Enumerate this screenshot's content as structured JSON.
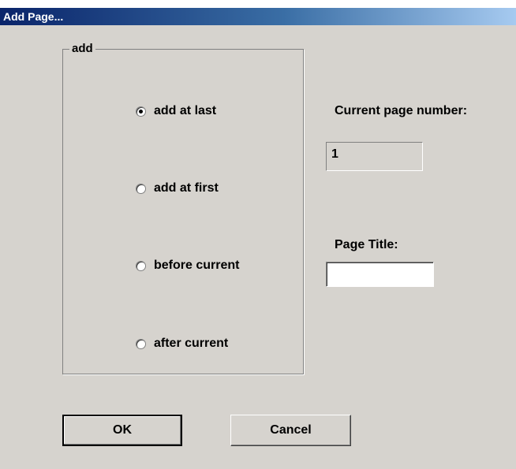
{
  "window": {
    "title": "Add Page..."
  },
  "add_group": {
    "legend": "add",
    "options": [
      {
        "label": "add at last",
        "selected": true
      },
      {
        "label": "add at first",
        "selected": false
      },
      {
        "label": "before current",
        "selected": false
      },
      {
        "label": "after current",
        "selected": false
      }
    ]
  },
  "current_page": {
    "label": "Current page number:",
    "value": "1"
  },
  "page_title": {
    "label": "Page Title:",
    "value": ""
  },
  "buttons": {
    "ok": "OK",
    "cancel": "Cancel"
  }
}
